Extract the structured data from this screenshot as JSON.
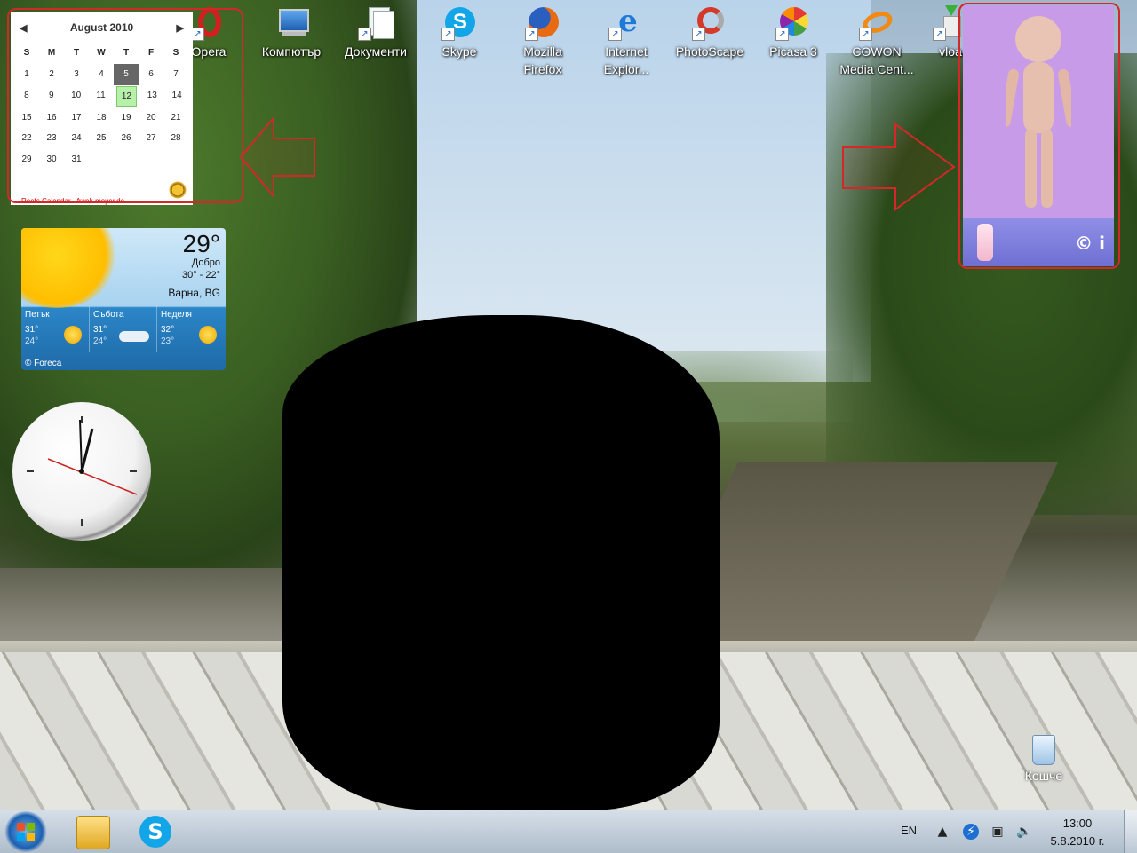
{
  "desktop_icons": [
    {
      "name": "opera",
      "label": "Opera",
      "color": "#d31f1f"
    },
    {
      "name": "computer",
      "label": "Компютър",
      "color": "#2a6bc2"
    },
    {
      "name": "documents",
      "label": "Документи",
      "color": "#d9d9d9"
    },
    {
      "name": "skype",
      "label": "Skype",
      "color": "#12a5e8"
    },
    {
      "name": "firefox",
      "label": "Mozilla Firefox",
      "color": "#e86a12"
    },
    {
      "name": "internet-explorer",
      "label": "Internet Explor...",
      "color": "#1d7ad8"
    },
    {
      "name": "photoscape",
      "label": "PhotoScape",
      "color": "#d43a2a"
    },
    {
      "name": "picasa",
      "label": "Picasa 3",
      "color": "#7a3fc8"
    },
    {
      "name": "cowon",
      "label": "COWON Media Cent...",
      "color": "#f08a12"
    },
    {
      "name": "vloa",
      "label": "vloa",
      "color": "#3ab03a"
    }
  ],
  "calendar": {
    "month": "August 2010",
    "weekdays": [
      "S",
      "M",
      "T",
      "W",
      "T",
      "F",
      "S"
    ],
    "weeks": [
      [
        "1",
        "2",
        "3",
        "4",
        "5",
        "6",
        "7"
      ],
      [
        "8",
        "9",
        "10",
        "11",
        "12",
        "13",
        "14"
      ],
      [
        "15",
        "16",
        "17",
        "18",
        "19",
        "20",
        "21"
      ],
      [
        "22",
        "23",
        "24",
        "25",
        "26",
        "27",
        "28"
      ],
      [
        "29",
        "30",
        "31",
        "",
        "",
        "",
        ""
      ]
    ],
    "today": "5",
    "marked": "12",
    "credit": "Reefs Calendar - frank-meyer.de"
  },
  "weather": {
    "temp": "29°",
    "condition": "Добро",
    "range": "30° - 22°",
    "location": "Варна, BG",
    "forecast": [
      {
        "day": "Петък",
        "hi": "31°",
        "lo": "24°",
        "icon": "sunny-icon"
      },
      {
        "day": "Събота",
        "hi": "31°",
        "lo": "24°",
        "icon": "cloudy-icon"
      },
      {
        "day": "Неделя",
        "hi": "32°",
        "lo": "23°",
        "icon": "sunny-icon"
      }
    ],
    "provider": "© Foreca"
  },
  "baby_gadget": {
    "copyright_button": "©",
    "info_button": "i"
  },
  "recycle_bin": {
    "label": "Кошче"
  },
  "taskbar": {
    "language": "EN",
    "time": "13:00",
    "date": "5.8.2010 г.",
    "pinned": [
      {
        "name": "explorer",
        "color": "#f0c040"
      },
      {
        "name": "skype",
        "color": "#12a5e8"
      }
    ]
  },
  "colors": {
    "highlight_outline": "#d42828",
    "baby_bg": "#c89be9"
  }
}
